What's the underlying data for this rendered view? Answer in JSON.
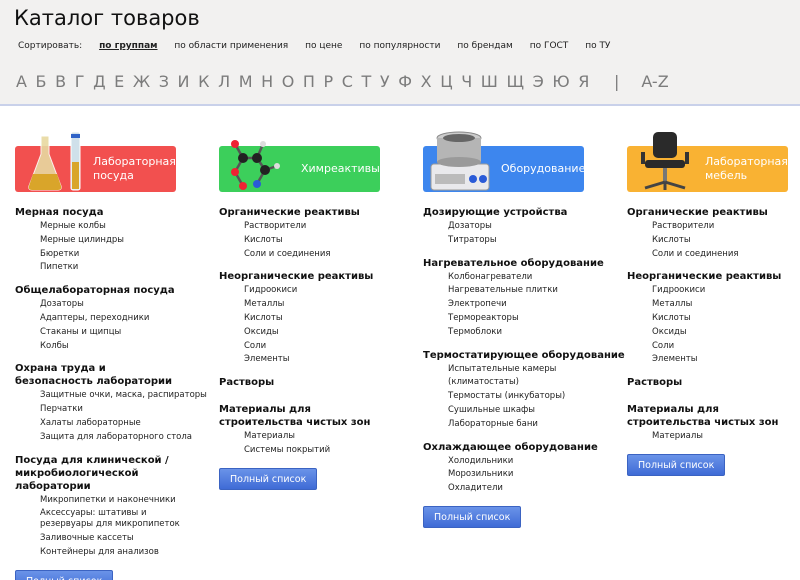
{
  "header": {
    "title": "Каталог товаров",
    "sort_label": "Сортировать:",
    "sort_options": [
      "по группам",
      "по области применения",
      "по цене",
      "по популярности",
      "по брендам",
      "по ГОСТ",
      "по ТУ"
    ],
    "active_sort": "по группам",
    "alphabet": [
      "А",
      "Б",
      "В",
      "Г",
      "Д",
      "Е",
      "Ж",
      "З",
      "И",
      "К",
      "Л",
      "М",
      "Н",
      "О",
      "П",
      "Р",
      "С",
      "Т",
      "У",
      "Ф",
      "Х",
      "Ц",
      "Ч",
      "Ш",
      "Щ",
      "Э",
      "Ю",
      "Я"
    ],
    "alphabet_separator": "|",
    "alphabet_latin": "A-Z"
  },
  "columns": [
    {
      "banner": {
        "label": "Лабораторная посуда",
        "color": "#f2504f"
      },
      "sections": [
        {
          "title": "Мерная посуда",
          "items": [
            "Мерные колбы",
            "Мерные цилиндры",
            "Бюретки",
            "Пипетки"
          ]
        },
        {
          "title": "Общелабораторная посуда",
          "items": [
            "Дозаторы",
            "Адаптеры, переходники",
            "Стаканы и щипцы",
            "Колбы"
          ]
        },
        {
          "title": "Охрана труда и безопасность лаборатории",
          "items": [
            "Защитные очки, маска, распираторы",
            "Перчатки",
            "Халаты лабораторные",
            "Защита для лабораторного стола"
          ]
        },
        {
          "title": "Посуда для клинической / микробиологической лаборатории",
          "items": [
            "Микропипетки и наконечники",
            "Аксессуары: штативы и резервуары для микропипеток",
            "Заливочные кассеты",
            "Контейнеры для анализов"
          ]
        }
      ],
      "button": "Полный список"
    },
    {
      "banner": {
        "label": "Химреактивы",
        "color": "#3ccf5b"
      },
      "sections": [
        {
          "title": "Органические реактивы",
          "items": [
            "Растворители",
            "Кислоты",
            "Соли и соединения"
          ]
        },
        {
          "title": "Неорганические реактивы",
          "items": [
            "Гидроокиси",
            "Металлы",
            "Кислоты",
            "Оксиды",
            "Соли",
            "Элементы"
          ]
        },
        {
          "title": "Растворы",
          "items": []
        },
        {
          "title": "Материалы для строительства чистых зон",
          "items": [
            "Материалы",
            "Системы покрытий"
          ]
        }
      ],
      "button": "Полный список"
    },
    {
      "banner": {
        "label": "Оборудование",
        "color": "#3d86ee"
      },
      "sections": [
        {
          "title": "Дозирующие устройства",
          "items": [
            "Дозаторы",
            "Титраторы"
          ]
        },
        {
          "title": "Нагревательное оборудование",
          "items": [
            "Колбонагреватели",
            "Нагревательные плитки",
            "Электропечи",
            "Термореакторы",
            "Термоблоки"
          ]
        },
        {
          "title": "Термостатирующее оборудование",
          "items": [
            "Испытательные камеры (климатостаты)",
            "Термостаты (инкубаторы)",
            "Сушильные шкафы",
            "Лабораторные бани"
          ]
        },
        {
          "title": "Охлаждающее оборудование",
          "items": [
            "Холодильники",
            "Морозильники",
            "Охладители"
          ]
        }
      ],
      "button": "Полный список"
    },
    {
      "banner": {
        "label": "Лабораторная мебель",
        "color": "#f9b233"
      },
      "sections": [
        {
          "title": "Органические реактивы",
          "items": [
            "Растворители",
            "Кислоты",
            "Соли и соединения"
          ]
        },
        {
          "title": "Неорганические реактивы",
          "items": [
            "Гидроокиси",
            "Металлы",
            "Кислоты",
            "Оксиды",
            "Соли",
            "Элементы"
          ]
        },
        {
          "title": "Растворы",
          "items": []
        },
        {
          "title": "Материалы для строительства чистых зон",
          "items": [
            "Материалы"
          ]
        }
      ],
      "button": "Полный список"
    }
  ]
}
